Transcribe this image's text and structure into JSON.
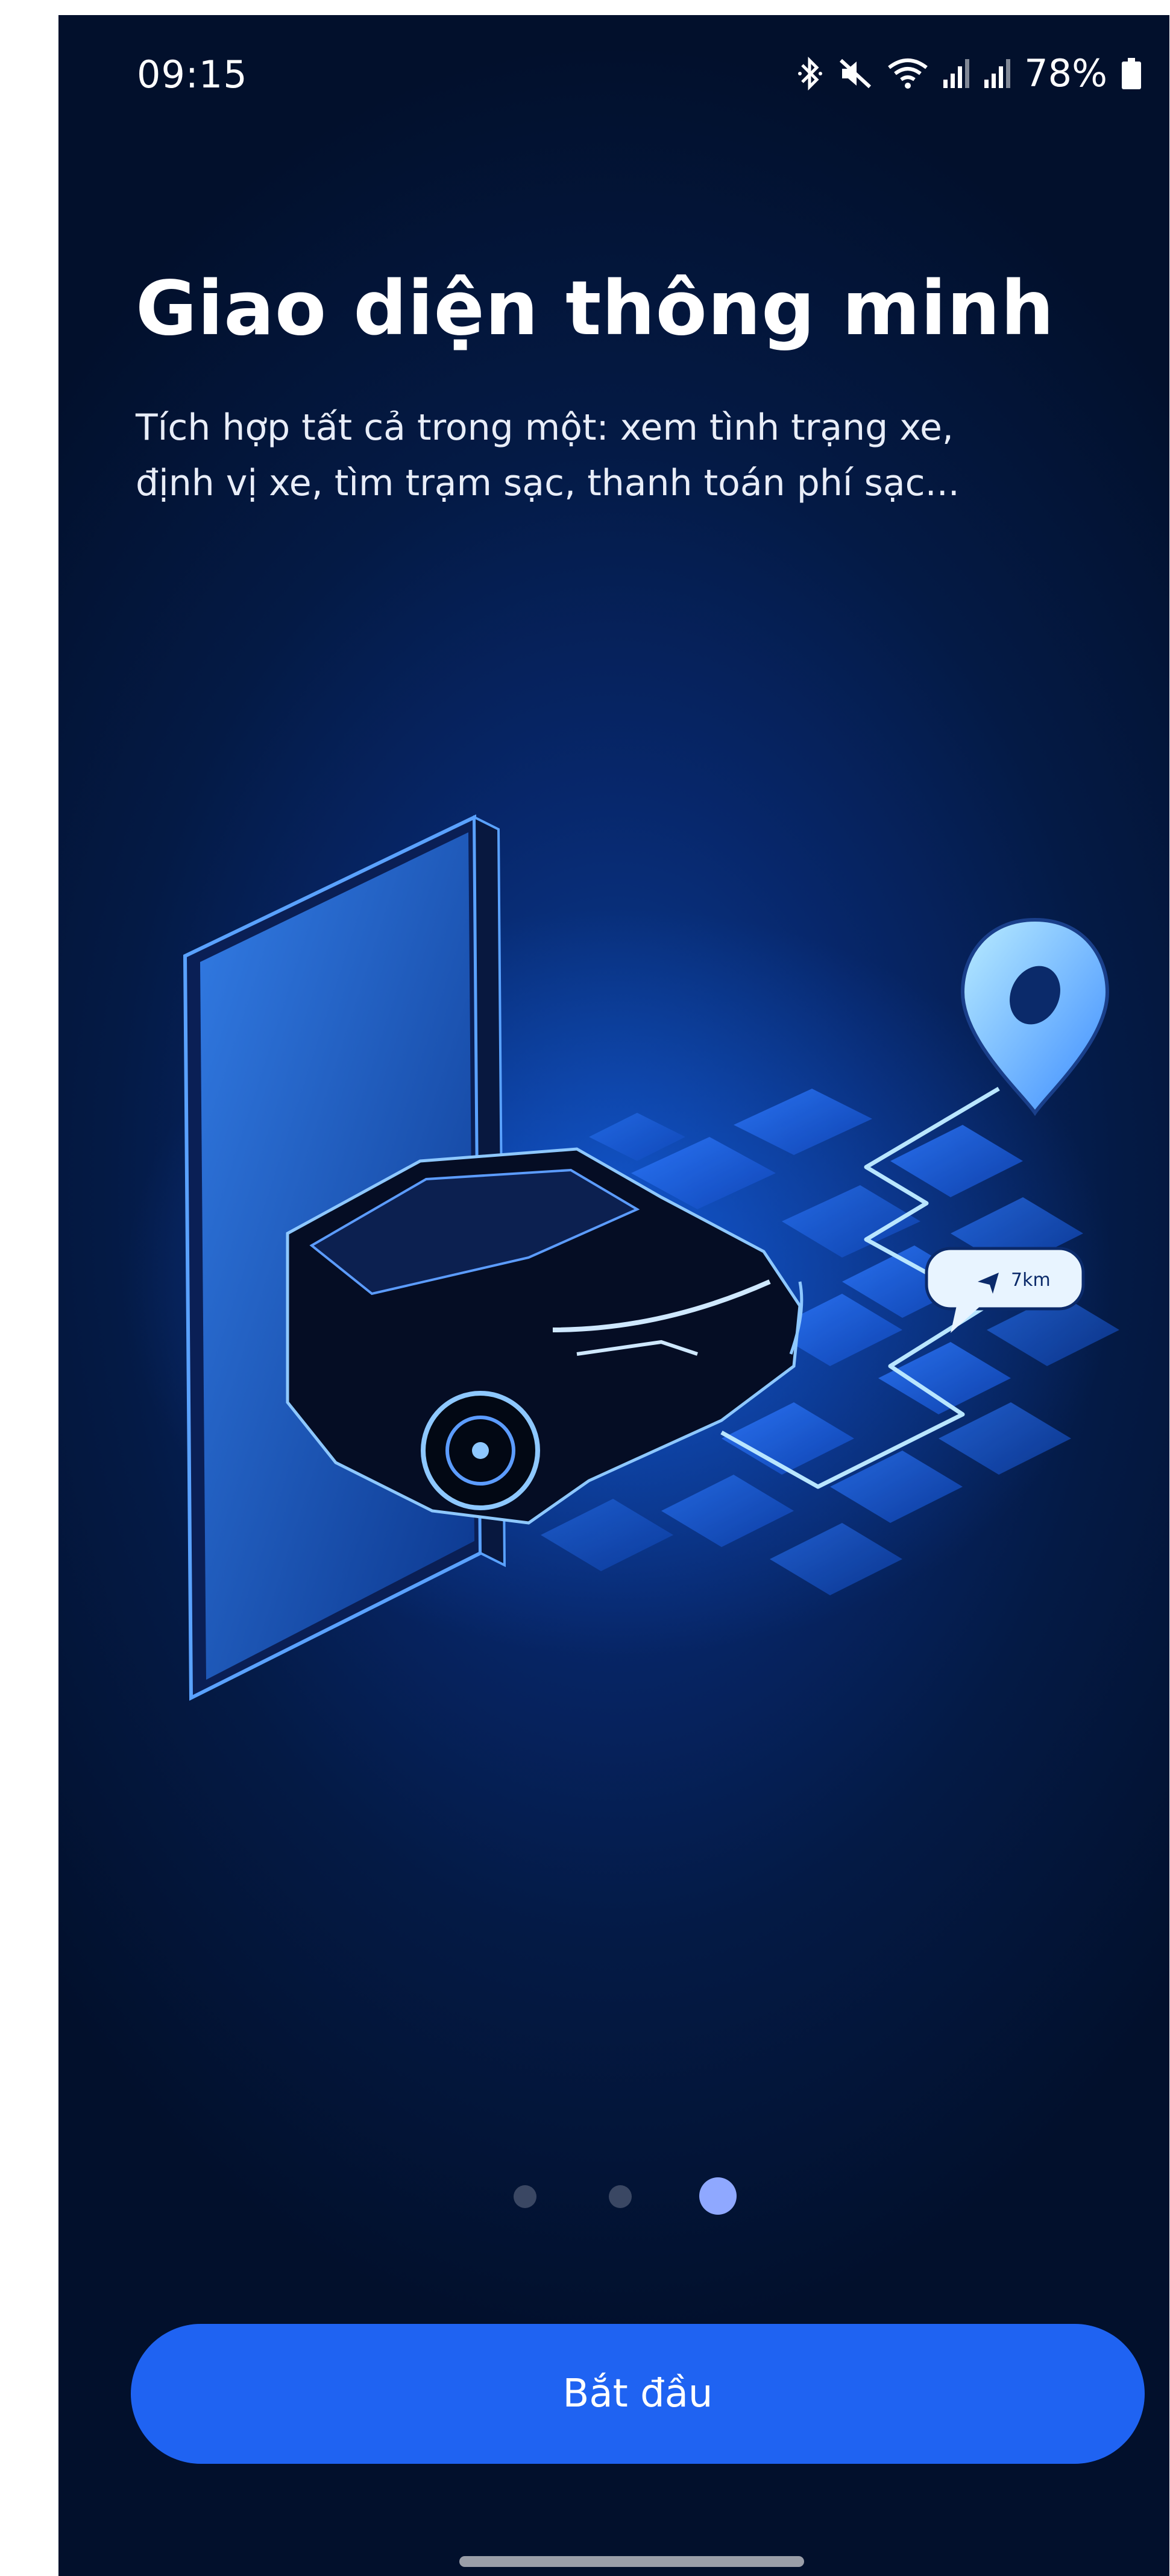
{
  "status_bar": {
    "time": "09:15",
    "battery": "78%",
    "icons": [
      "bluetooth-icon",
      "mute-icon",
      "wifi-icon",
      "signal-icon",
      "signal-icon",
      "battery-icon"
    ]
  },
  "onboarding": {
    "title": "Giao diện thông minh",
    "subtitle_lines": [
      "Tích hợp tất cả trong một: xem tình trạng xe,",
      "định vị xe, tìm trạm sạc, thanh toán phí sạc..."
    ],
    "distance_label": "7km",
    "page_count": 3,
    "active_page": 3
  },
  "actions": {
    "start_label": "Bắt đầu"
  },
  "colors": {
    "background": "#041a45",
    "primary": "#1f63f2",
    "active_dot": "#8fa8ff",
    "inactive_dot": "#3a4763"
  }
}
